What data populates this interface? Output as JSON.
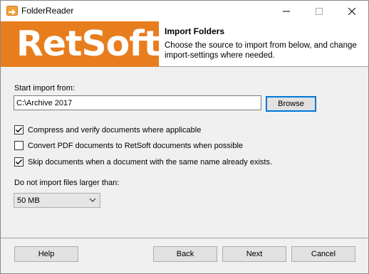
{
  "window": {
    "title": "FolderReader",
    "icon": "folder-icon"
  },
  "banner": {
    "logo_text": "RetSoft",
    "title": "Import Folders",
    "description": "Choose the source to import from below, and change import-settings where needed.",
    "logo_color": "#e87d1e"
  },
  "source": {
    "label": "Start import from:",
    "path": "C:\\Archive 2017",
    "browse_label": "Browse"
  },
  "options": [
    {
      "label": "Compress and verify documents where applicable",
      "checked": true
    },
    {
      "label": "Convert PDF documents to RetSoft documents when possible",
      "checked": false
    },
    {
      "label": "Skip documents when a document with the same name already exists.",
      "checked": true
    }
  ],
  "size_limit": {
    "label": "Do not import files larger than:",
    "selected": "50 MB"
  },
  "footer": {
    "help_label": "Help",
    "back_label": "Back",
    "next_label": "Next",
    "cancel_label": "Cancel"
  }
}
